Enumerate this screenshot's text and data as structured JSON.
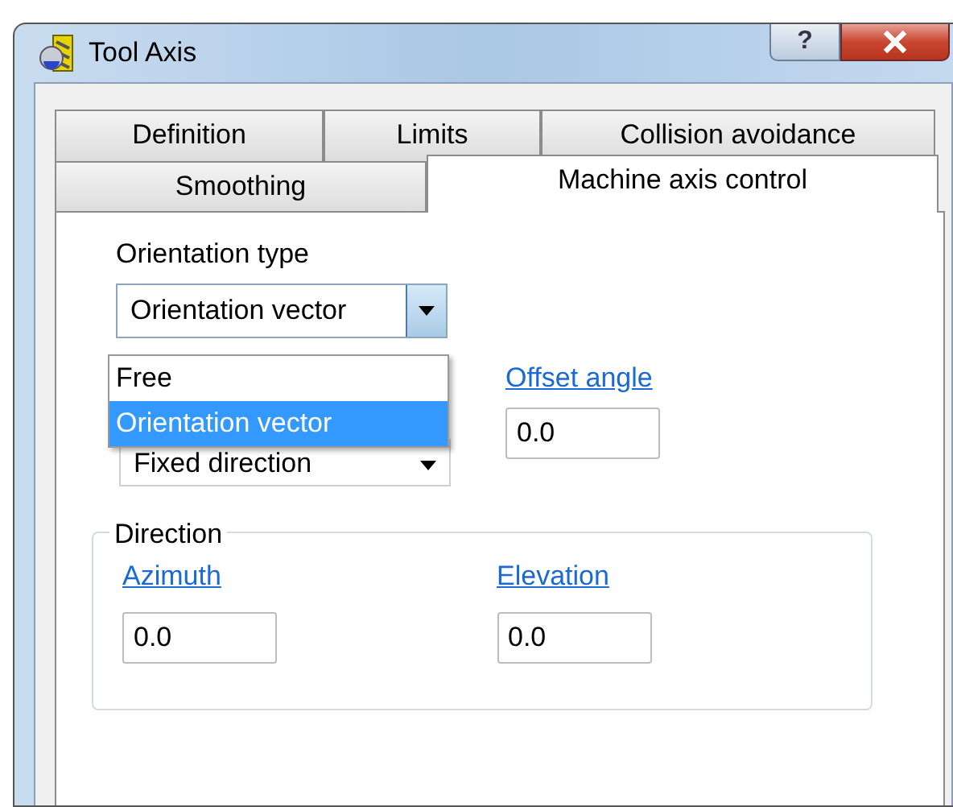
{
  "window": {
    "title": "Tool Axis",
    "help_button": "?"
  },
  "tab_rows": [
    [
      {
        "label": "Definition",
        "selected": false
      },
      {
        "label": "Limits",
        "selected": false
      },
      {
        "label": "Collision avoidance",
        "selected": false
      }
    ],
    [
      {
        "label": "Smoothing",
        "selected": false
      },
      {
        "label": "Machine axis control",
        "selected": true
      }
    ]
  ],
  "orientation_type": {
    "label": "Orientation type",
    "value": "Orientation vector",
    "expanded": true,
    "options": [
      {
        "label": "Free",
        "selected": false
      },
      {
        "label": "Orientation vector",
        "selected": true
      }
    ]
  },
  "second_select": {
    "value": "Fixed direction"
  },
  "offset_angle": {
    "label": "Offset angle",
    "value": "0.0"
  },
  "direction": {
    "title": "Direction",
    "fields": [
      {
        "label": "Azimuth",
        "value": "0.0"
      },
      {
        "label": "Elevation",
        "value": "0.0"
      }
    ]
  }
}
